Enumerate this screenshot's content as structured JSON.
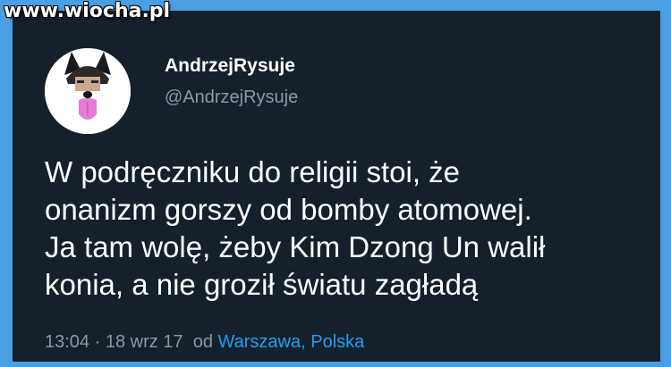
{
  "watermark": "www.wiocha.pl",
  "user": {
    "display_name": "AndrzejRysuje",
    "handle": "@AndrzejRysuje"
  },
  "tweet": {
    "lines": [
      "W podręczniku do religii stoi, że",
      "onanizm gorszy od bomby atomowej.",
      "Ja tam wolę, żeby Kim Dzong Un walił",
      "konia, a nie groził światu zagładą"
    ]
  },
  "meta": {
    "time": "13:04",
    "separator": "·",
    "date": "18 wrz 17",
    "from_label": "od",
    "location": "Warszawa, Polska"
  },
  "colors": {
    "background": "#15202b",
    "frame": "#4a9fe3",
    "text": "#ffffff",
    "muted": "#8899a6",
    "link": "#1da1f2"
  }
}
